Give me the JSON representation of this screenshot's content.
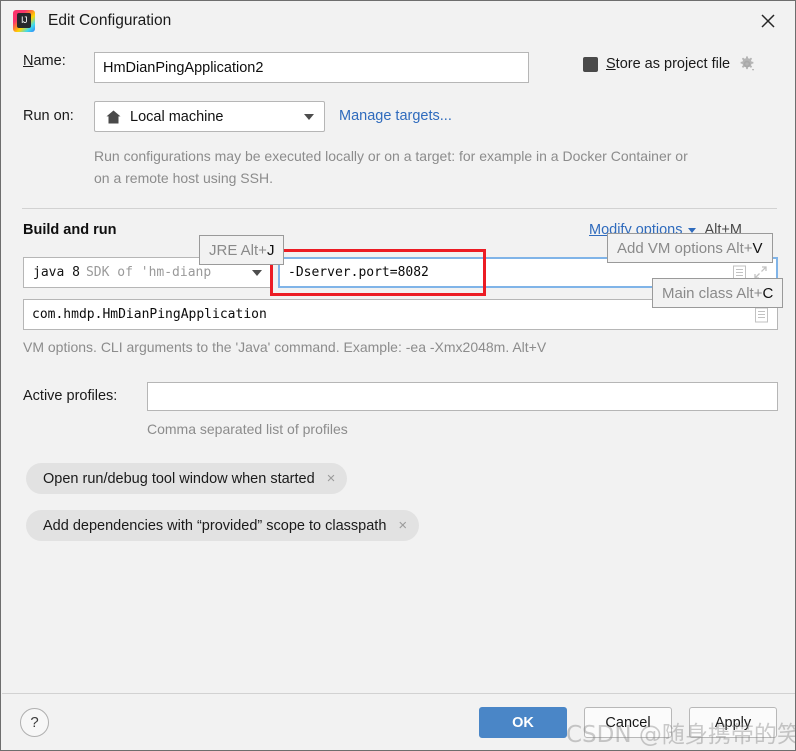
{
  "window": {
    "title": "Edit Configuration",
    "logo_alt": "IJ",
    "close_icon": "close-icon"
  },
  "name_row": {
    "label_prefix": "N",
    "label_rest": "ame:",
    "value": "HmDianPingApplication2"
  },
  "store_as_project_file": {
    "label_prefix": "S",
    "label_rest": "tore as project file",
    "checked": true,
    "gear_icon": "gear-icon"
  },
  "run_on": {
    "label": "Run on:",
    "selected": "Local machine",
    "home_icon": "home-icon",
    "manage_link": "Manage targets...",
    "description": "Run configurations may be executed locally or on a target: for example in a Docker Container or on a remote host using SSH."
  },
  "build_and_run": {
    "section_title": "Build and run",
    "modify_options": {
      "label": "Modify options",
      "shortcut": "Alt+M"
    },
    "jre": {
      "java_version": "java 8",
      "sdk_text": "SDK of 'hm-dianp"
    },
    "vm_options": {
      "value": "-Dserver.port=8082",
      "highlighted": true
    },
    "main_class": {
      "value": "com.hmdp.HmDianPingApplication"
    },
    "vm_hint": "VM options. CLI arguments to the 'Java' command. Example: -ea -Xmx2048m. Alt+V"
  },
  "tooltips": [
    {
      "text": "JRE Alt+",
      "accent": "J"
    },
    {
      "text": "Add VM options Alt+",
      "accent": "V"
    },
    {
      "text": "Main class Alt+",
      "accent": "C"
    }
  ],
  "active_profiles": {
    "label": "Active profiles:",
    "value": "",
    "hint": "Comma separated list of profiles"
  },
  "chips": [
    {
      "label": "Open run/debug tool window when started",
      "close": "×"
    },
    {
      "label": "Add dependencies with “provided” scope to classpath",
      "close": "×"
    }
  ],
  "footer": {
    "help": "?",
    "ok": "OK",
    "cancel": "Cancel",
    "apply": "Apply"
  },
  "watermark": "CSDN @随身携带的笑",
  "colors": {
    "accent_blue": "#4a86c7",
    "link_blue": "#2f6bbd",
    "highlight_red": "#ec1c24",
    "focus_border": "#80b4e8",
    "dialog_bg": "#f2f2f2"
  }
}
